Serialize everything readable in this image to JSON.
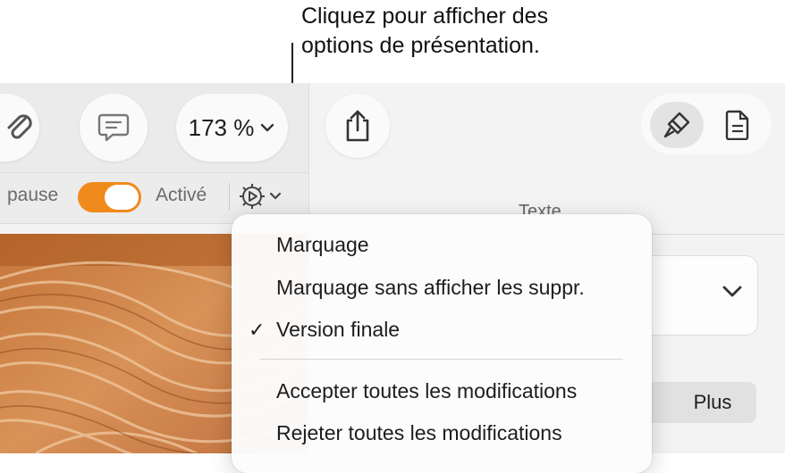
{
  "callout": {
    "line1": "Cliquez pour afficher des",
    "line2": "options de présentation."
  },
  "toolbar": {
    "zoom": "173 %",
    "attach_icon": "paperclip-icon",
    "comment_icon": "comment-icon",
    "share_icon": "share-icon",
    "format_icon": "paintbrush-icon",
    "document_icon": "document-icon"
  },
  "tracking": {
    "pause_label": "pause",
    "toggle_on": true,
    "active_label": "Activé",
    "view_options_icon": "gear-icon"
  },
  "sidebar": {
    "section_title": "Texte",
    "more_label": "Plus"
  },
  "menu": {
    "items": [
      {
        "label": "Marquage",
        "checked": false
      },
      {
        "label": "Marquage sans afficher les suppr.",
        "checked": false
      },
      {
        "label": "Version finale",
        "checked": true
      },
      {
        "label": "Accepter toutes les modifications",
        "checked": false
      },
      {
        "label": "Rejeter toutes les modifications",
        "checked": false
      }
    ],
    "check_glyph": "✓"
  },
  "colors": {
    "accent": "#f08a1c",
    "window_bg": "#f3f3f3",
    "menu_bg": "#fcfcfc"
  }
}
